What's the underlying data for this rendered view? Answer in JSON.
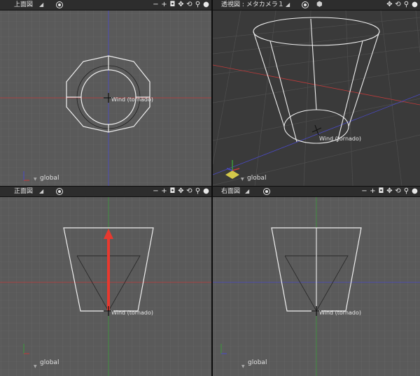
{
  "views": {
    "top": {
      "title": "上面図"
    },
    "persp": {
      "title": "透視図 : メタカメラ１"
    },
    "front": {
      "title": "正面図"
    },
    "right": {
      "title": "右面図"
    }
  },
  "object_label": "Wind (tornado)",
  "space_label": "global",
  "toolbar_glyphs": {
    "minus": "−",
    "plus": "+",
    "camera": "◘",
    "move": "✥",
    "rotate": "⟲",
    "zoom": "⚲",
    "sphere": "●"
  },
  "colors": {
    "grid_bg": "#5a5a5a",
    "persp_bg": "#3a3a3a",
    "x_axis": "#c23a3a",
    "y_axis": "#3b9a3b",
    "z_axis": "#4a4ac8",
    "arrow": "#e8392f"
  }
}
